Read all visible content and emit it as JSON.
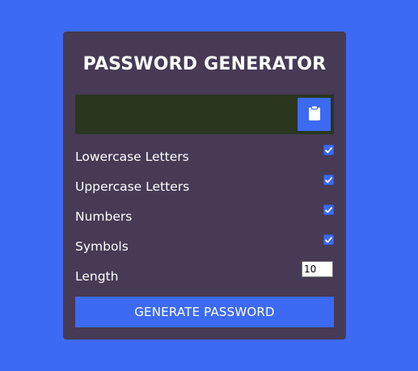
{
  "app": {
    "title": "PASSWORD GENERATOR"
  },
  "result": {
    "value": ""
  },
  "icons": {
    "clipboard": "clipboard-icon",
    "checkbox": "checkmark-icon"
  },
  "options": [
    {
      "label": "Lowercase Letters",
      "checked": true
    },
    {
      "label": "Uppercase Letters",
      "checked": true
    },
    {
      "label": "Numbers",
      "checked": true
    },
    {
      "label": "Symbols",
      "checked": true
    }
  ],
  "length": {
    "label": "Length",
    "value": "10"
  },
  "generate_button": {
    "label": "GENERATE PASSWORD"
  },
  "colors": {
    "background": "#3d6af2",
    "card": "#463a55",
    "result_box": "#2a361f",
    "accent": "#3d6af2",
    "text": "#ffffff"
  }
}
